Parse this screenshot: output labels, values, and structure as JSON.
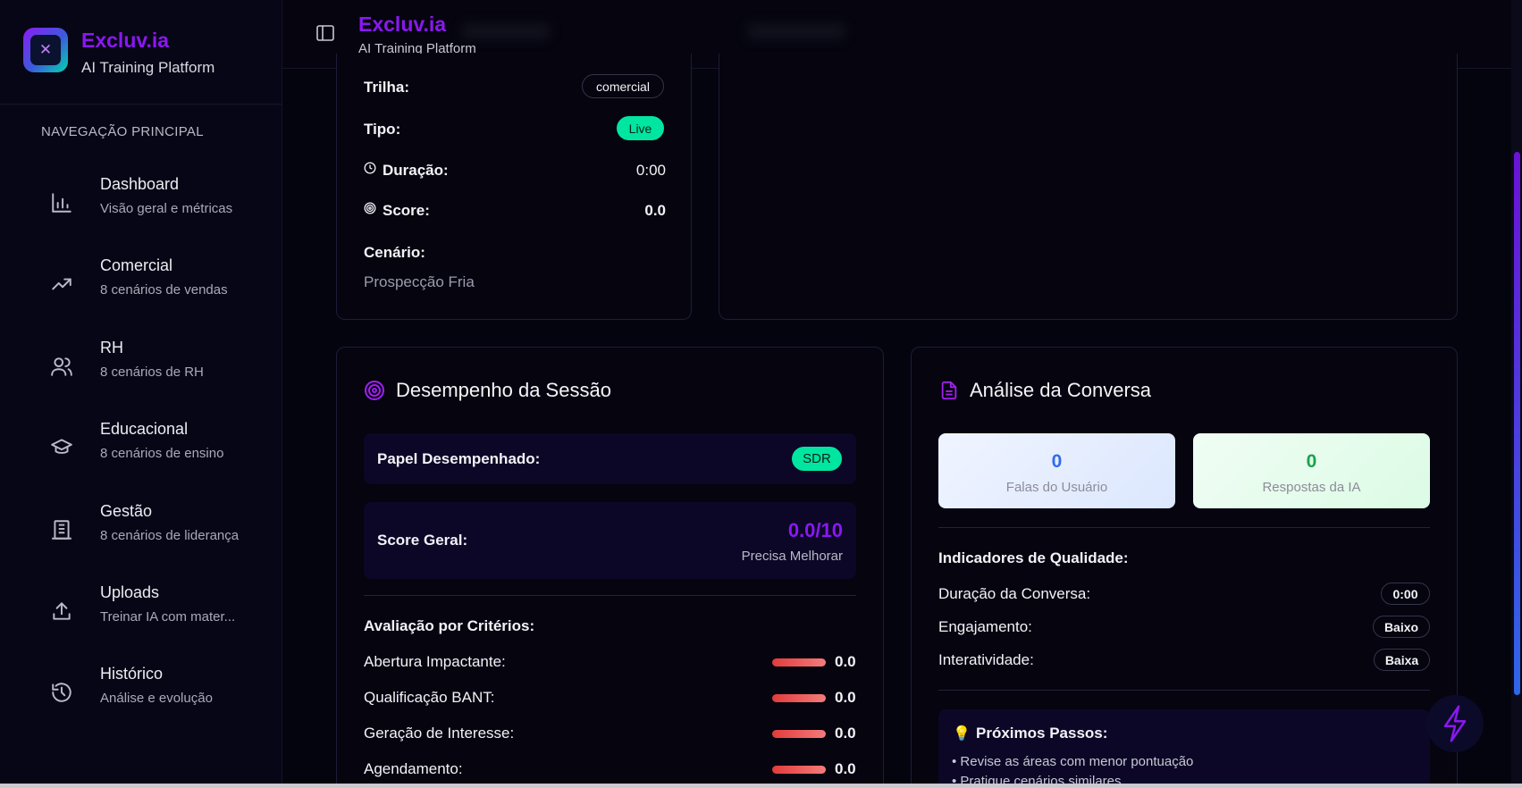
{
  "brand": {
    "title": "Excluv.ia",
    "subtitle": "AI Training Platform"
  },
  "sidebar": {
    "heading": "NAVEGAÇÃO PRINCIPAL",
    "items": [
      {
        "title": "Dashboard",
        "sub": "Visão geral e métricas",
        "icon": "bar-chart-icon"
      },
      {
        "title": "Comercial",
        "sub": "8 cenários de vendas",
        "icon": "trending-up-icon"
      },
      {
        "title": "RH",
        "sub": "8 cenários de RH",
        "icon": "users-icon"
      },
      {
        "title": "Educacional",
        "sub": "8 cenários de ensino",
        "icon": "graduation-cap-icon"
      },
      {
        "title": "Gestão",
        "sub": "8 cenários de liderança",
        "icon": "building-icon"
      },
      {
        "title": "Uploads",
        "sub": "Treinar IA com mater...",
        "icon": "upload-icon"
      },
      {
        "title": "Histórico",
        "sub": "Análise e evolução",
        "icon": "history-icon"
      }
    ]
  },
  "topbar": {
    "title": "Excluv.ia",
    "subtitle": "AI Training Platform"
  },
  "session_info": {
    "track_label": "Trilha:",
    "track_value": "comercial",
    "type_label": "Tipo:",
    "type_value": "Live",
    "duration_label": "Duração:",
    "duration_value": "0:00",
    "score_label": "Score:",
    "score_value": "0.0",
    "scenario_label": "Cenário:",
    "scenario_value": "Prospecção Fria"
  },
  "performance": {
    "title": "Desempenho da Sessão",
    "role_label": "Papel Desempenhado:",
    "role_value": "SDR",
    "score_label": "Score Geral:",
    "score_value": "0.0/10",
    "score_status": "Precisa Melhorar",
    "criteria_title": "Avaliação por Critérios:",
    "criteria": [
      {
        "label": "Abertura Impactante:",
        "value": "0.0"
      },
      {
        "label": "Qualificação BANT:",
        "value": "0.0"
      },
      {
        "label": "Geração de Interesse:",
        "value": "0.0"
      },
      {
        "label": "Agendamento:",
        "value": "0.0"
      }
    ]
  },
  "analysis": {
    "title": "Análise da Conversa",
    "user_count": "0",
    "user_label": "Falas do Usuário",
    "ai_count": "0",
    "ai_label": "Respostas da IA",
    "quality_title": "Indicadores de Qualidade:",
    "indicators": [
      {
        "label": "Duração da Conversa:",
        "value": "0:00"
      },
      {
        "label": "Engajamento:",
        "value": "Baixo"
      },
      {
        "label": "Interatividade:",
        "value": "Baixa"
      }
    ],
    "next_title": "Próximos Passos:",
    "next_items": [
      "• Revise as áreas com menor pontuação",
      "• Pratique cenários similares"
    ]
  },
  "colors": {
    "accent": "#8a18f0",
    "live": "#00e6a0",
    "bar": "#e23b3b"
  }
}
